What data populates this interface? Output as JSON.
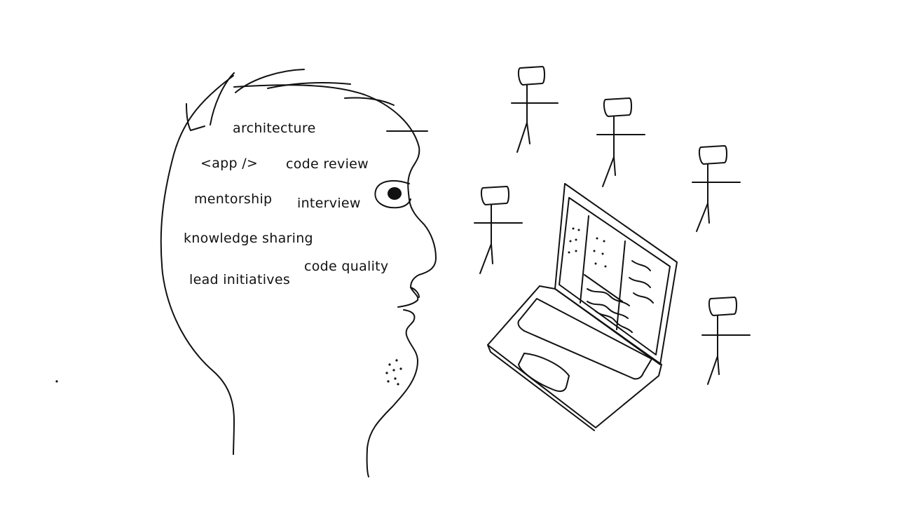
{
  "sketch": {
    "head_words": [
      "architecture",
      "<app />",
      "code review",
      "mentorship",
      "interview",
      "knowledge sharing",
      "code quality",
      "lead initiatives"
    ],
    "stick_figures": [
      "figure",
      "figure",
      "figure",
      "figure",
      "figure"
    ],
    "laptop": "laptop"
  },
  "colors": {
    "ink": "#111111",
    "background": "#ffffff"
  }
}
